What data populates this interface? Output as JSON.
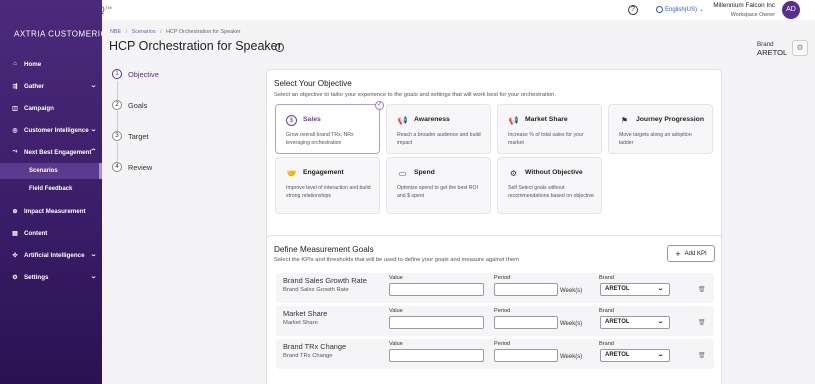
{
  "app": {
    "logo_text": "AXTRIA CUSTOMERIQ",
    "logo_tm": "TM"
  },
  "topbar": {
    "help_icon": "?",
    "language": "English(US)",
    "user_name": "Millennium Falcon Inc",
    "user_role": "Workspace Owner",
    "avatar_initials": "AD"
  },
  "sidebar": {
    "items": [
      {
        "label": "Home",
        "icon": "home-icon"
      },
      {
        "label": "Gather",
        "icon": "gather-icon"
      },
      {
        "label": "Campaign",
        "icon": "campaign-icon"
      },
      {
        "label": "Customer Intelligence",
        "icon": "customer-intelligence-icon"
      },
      {
        "label": "Next Best Engagement",
        "icon": "engagement-icon"
      },
      {
        "label": "Scenarios"
      },
      {
        "label": "Field Feedback"
      },
      {
        "label": "Impact Measurement",
        "icon": "impact-icon"
      },
      {
        "label": "Content",
        "icon": "content-icon"
      },
      {
        "label": "Artificial Intelligence",
        "icon": "ai-icon"
      },
      {
        "label": "Settings",
        "icon": "settings-icon"
      }
    ]
  },
  "breadcrumb": {
    "items": [
      "NBE",
      "Scenarios",
      "HCP Orchestration for Speaker"
    ],
    "sep": "/"
  },
  "page": {
    "title": "HCP Orchestration for Speaker",
    "info_icon": "i",
    "brand_label": "Brand",
    "brand_value": "ARETOL"
  },
  "steps": [
    {
      "num": "1",
      "label": "Objective"
    },
    {
      "num": "2",
      "label": "Goals"
    },
    {
      "num": "3",
      "label": "Target"
    },
    {
      "num": "4",
      "label": "Review"
    }
  ],
  "objective": {
    "title": "Select Your Objective",
    "subtitle": "Select an objective to tailor your experience to the goals and settings that will work best for your orchestration.",
    "options": [
      {
        "title": "Sales",
        "desc": "Grow overall brand TRx, NRx leveraging orchestration",
        "icon": "$"
      },
      {
        "title": "Awareness",
        "desc": "Reach a broader audience and build impact",
        "icon": "megaphone-icon"
      },
      {
        "title": "Market Share",
        "desc": "Increase % of total sales for your market",
        "icon": "megaphone-icon"
      },
      {
        "title": "Journey Progression",
        "desc": "Move targets along an adoption ladder",
        "icon": "flag-icon"
      },
      {
        "title": "Engagement",
        "desc": "Improve level of interaction and build strong relationships",
        "icon": "handshake-icon"
      },
      {
        "title": "Spend",
        "desc": "Optimize spend to get the best ROI and $ spent",
        "icon": "wallet-icon"
      },
      {
        "title": "Without Objective",
        "desc": "Self Select goals without recommendations based on objective",
        "icon": "gear-icon"
      }
    ]
  },
  "goals": {
    "title": "Define Measurement Goals",
    "subtitle": "Select the KPIs and thresholds that will be used to define your goals and measure against them",
    "add_kpi": "Add KPI",
    "labels": {
      "value": "Value",
      "period": "Period",
      "brand": "Brand",
      "weeks": "Week(s)"
    },
    "rows": [
      {
        "name": "Brand Sales Growth Rate",
        "sub": "Brand Sales Growth Rate",
        "brand": "ARETOL"
      },
      {
        "name": "Market Share",
        "sub": "Market Share",
        "brand": "ARETOL"
      },
      {
        "name": "Brand TRx Change",
        "sub": "Brand TRx Change",
        "brand": "ARETOL"
      }
    ]
  }
}
